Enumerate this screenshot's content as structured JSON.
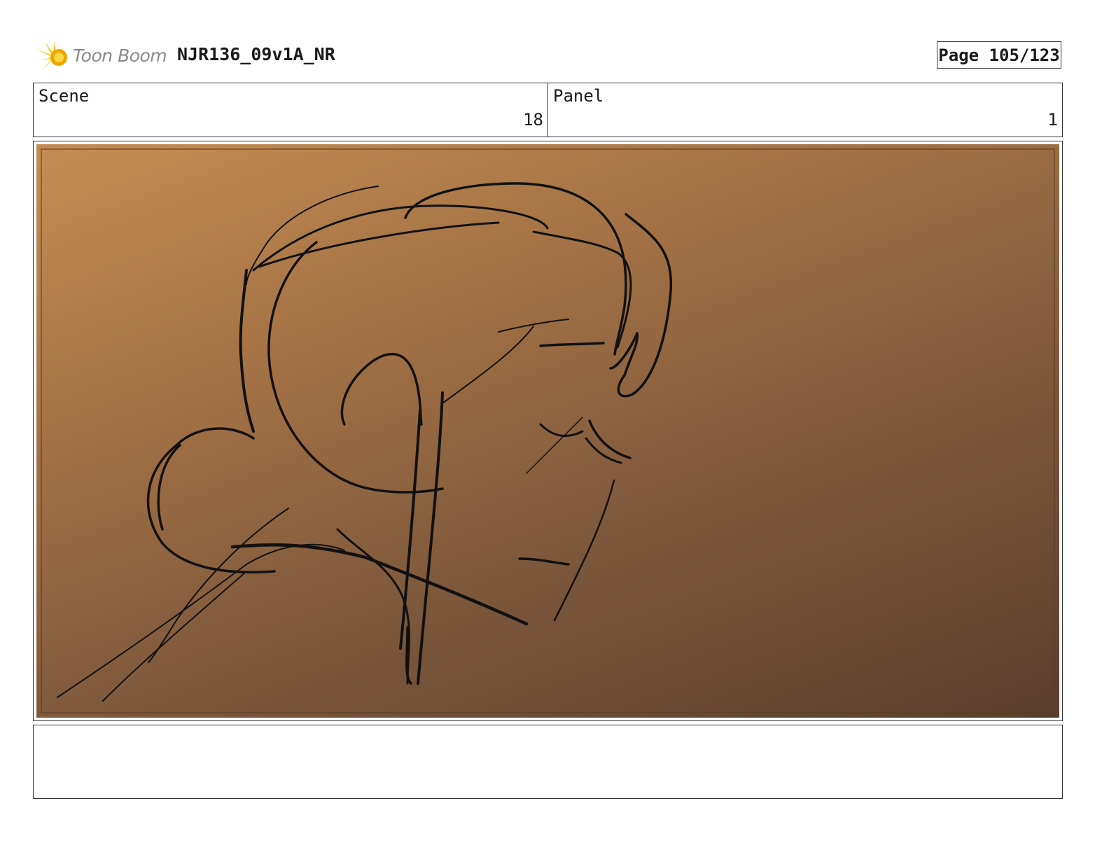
{
  "header": {
    "logo_text": "Toon Boom",
    "title": "NJR136_09v1A_NR",
    "page_label": "Page 105/123"
  },
  "info": {
    "scene_label": "Scene",
    "scene_value": "18",
    "panel_label": "Panel",
    "panel_value": "1"
  },
  "panel": {
    "image_description_icon": "storyboard-sketch",
    "background_colors": [
      "#c58d53",
      "#5a3e2d"
    ]
  },
  "notes": {
    "text": ""
  }
}
